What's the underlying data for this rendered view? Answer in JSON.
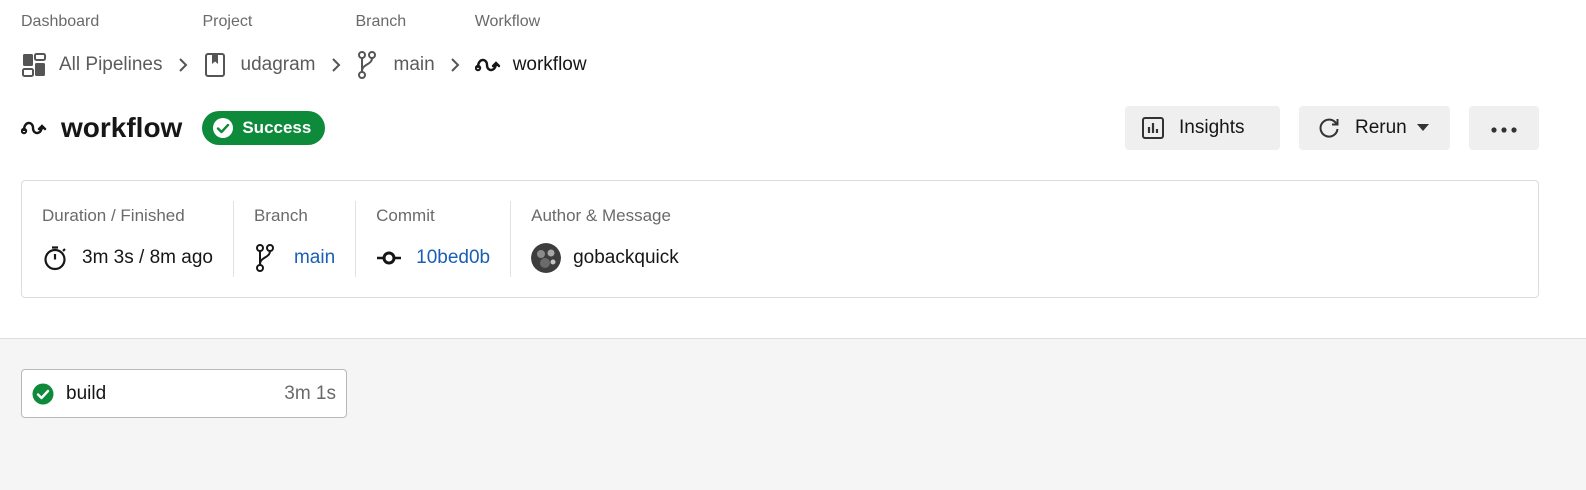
{
  "breadcrumb": [
    {
      "caption": "Dashboard",
      "label": "All Pipelines",
      "icon": "dashboard-icon"
    },
    {
      "caption": "Project",
      "label": "udagram",
      "icon": "bookmark-icon"
    },
    {
      "caption": "Branch",
      "label": "main",
      "icon": "branch-icon"
    },
    {
      "caption": "Workflow",
      "label": "workflow",
      "icon": "workflow-icon"
    }
  ],
  "title": "workflow",
  "status_badge": "Success",
  "actions": {
    "insights": "Insights",
    "rerun": "Rerun",
    "more": "more-icon"
  },
  "info": {
    "duration": {
      "caption": "Duration / Finished",
      "value": "3m 3s / 8m ago"
    },
    "branch": {
      "caption": "Branch",
      "value": "main"
    },
    "commit": {
      "caption": "Commit",
      "value": "10bed0b"
    },
    "author": {
      "caption": "Author & Message",
      "value": "gobackquick"
    }
  },
  "jobs": [
    {
      "name": "build",
      "duration": "3m 1s",
      "status": "success"
    }
  ],
  "colors": {
    "success": "#0e8a3b",
    "link": "#1a5fb4",
    "button_bg": "#efefef",
    "jobs_bg": "#f5f5f5"
  }
}
